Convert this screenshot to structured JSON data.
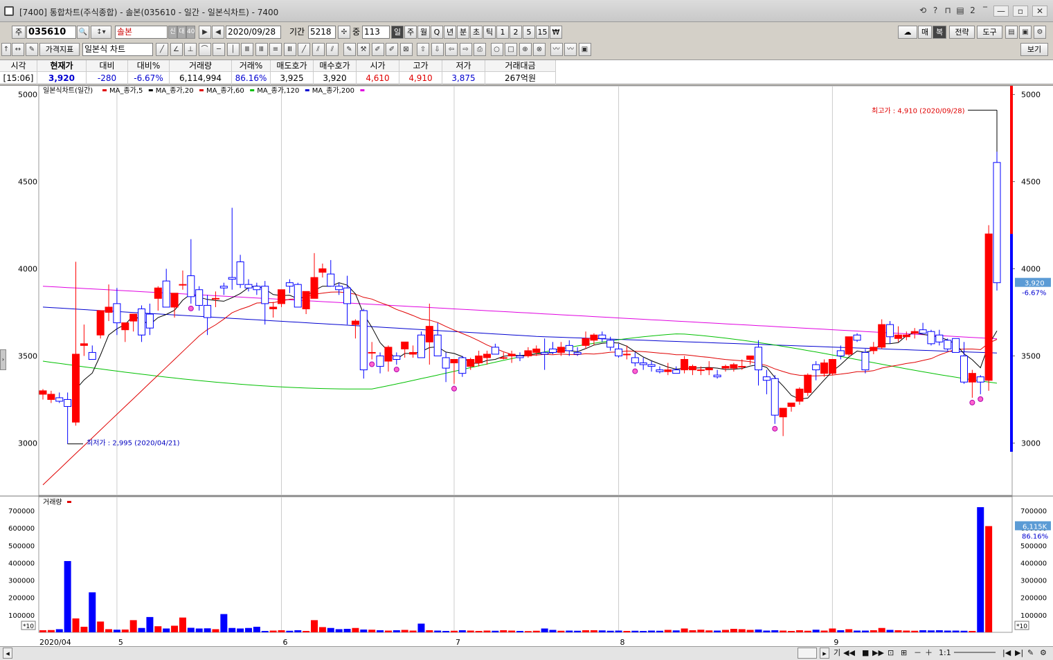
{
  "window": {
    "title": "[7400] 통합차트(주식종합) - 솔본(035610 - 일간 - 일본식차트) - 7400",
    "buttons": [
      "⟲",
      "?",
      "⊓",
      "▤",
      "2",
      "‾"
    ]
  },
  "toolbar": {
    "market_label": "주",
    "code": "035610",
    "name": "솔본",
    "small_labels": [
      "신",
      "대",
      "40"
    ],
    "date": "2020/09/28",
    "period_label": "기간",
    "period_value": "5218",
    "count_label": "중",
    "count_value": "113",
    "timeframes": [
      {
        "label": "일",
        "selected": true
      },
      {
        "label": "주"
      },
      {
        "label": "월"
      },
      {
        "label": "Q"
      },
      {
        "label": "년"
      },
      {
        "label": "분"
      },
      {
        "label": "초"
      },
      {
        "label": "틱"
      },
      {
        "label": "1"
      },
      {
        "label": "2"
      },
      {
        "label": "5"
      },
      {
        "label": "15"
      },
      {
        "label": "₩"
      }
    ],
    "right_buttons": [
      "매",
      "복",
      "전략",
      "도구"
    ],
    "indicator_label": "가격지표",
    "chart_type": "일본식 차트",
    "view_label": "보기"
  },
  "info": {
    "headers": [
      "시각",
      "현재가",
      "대비",
      "대비%",
      "거래량",
      "거래%",
      "매도호가",
      "매수호가",
      "시가",
      "고가",
      "저가",
      "거래대금"
    ],
    "values": [
      "[15:06]",
      "3,920",
      "-280",
      "-6.67%",
      "6,114,994",
      "86.16%",
      "3,925",
      "3,920",
      "4,610",
      "4,910",
      "3,875",
      "267억원"
    ]
  },
  "legend": {
    "title": "일본식차트(일간)",
    "items": [
      {
        "label": "MA_종가,5",
        "color": "#e00000"
      },
      {
        "label": "MA_종가,20",
        "color": "#000000"
      },
      {
        "label": "MA_종가,60",
        "color": "#e00000"
      },
      {
        "label": "MA_종가,120",
        "color": "#00c000"
      },
      {
        "label": "MA_종가,200",
        "color": "#0000d0"
      }
    ],
    "extra_color": "#e000e0"
  },
  "price_axis": {
    "ticks": [
      "5000",
      "4500",
      "4000",
      "3500",
      "3000"
    ]
  },
  "annotations": {
    "high": "최고가 : 4,910 (2020/09/28)",
    "low": "최저가 : 2,995 (2020/04/21)"
  },
  "current_label": {
    "price": "3,920",
    "change": "-6.67%"
  },
  "volume": {
    "title": "거래량",
    "ticks": [
      "700000",
      "600000",
      "500000",
      "400000",
      "300000",
      "200000",
      "100000"
    ],
    "unit": "*10",
    "current": "6,115K",
    "pct": "86.16%"
  },
  "x_axis": {
    "labels": [
      "2020/04",
      "5",
      "6",
      "7",
      "8",
      "9"
    ]
  },
  "bottom_nav": [
    "기",
    "◀◀",
    "■",
    "▶▶",
    "⊡",
    "⊞",
    "－",
    "＋",
    "1:1"
  ],
  "colors": {
    "up": "#ff0000",
    "down": "#0000ff",
    "bg": "#ffffff"
  },
  "chart_data": {
    "type": "candlestick",
    "title": "일본식차트(일간)",
    "ylim": [
      2700,
      5050
    ],
    "candles": [
      {
        "o": 3280,
        "h": 3310,
        "l": 3250,
        "c": 3300
      },
      {
        "o": 3250,
        "h": 3300,
        "l": 3230,
        "c": 3280
      },
      {
        "o": 3260,
        "h": 3290,
        "l": 3230,
        "c": 3240
      },
      {
        "o": 3250,
        "h": 3290,
        "l": 2995,
        "c": 3210
      },
      {
        "o": 3120,
        "h": 4040,
        "l": 3100,
        "c": 3510
      },
      {
        "o": 3560,
        "h": 3680,
        "l": 3500,
        "c": 3570
      },
      {
        "o": 3520,
        "h": 3560,
        "l": 3480,
        "c": 3480
      },
      {
        "o": 3620,
        "h": 3700,
        "l": 3600,
        "c": 3760
      },
      {
        "o": 3750,
        "h": 3910,
        "l": 3700,
        "c": 3780
      },
      {
        "o": 3800,
        "h": 3890,
        "l": 3620,
        "c": 3690
      },
      {
        "o": 3650,
        "h": 3690,
        "l": 3580,
        "c": 3690
      },
      {
        "o": 3700,
        "h": 3740,
        "l": 3640,
        "c": 3740
      },
      {
        "o": 3770,
        "h": 3790,
        "l": 3580,
        "c": 3620
      },
      {
        "o": 3740,
        "h": 3800,
        "l": 3620,
        "c": 3660
      },
      {
        "o": 3830,
        "h": 3900,
        "l": 3760,
        "c": 3890
      },
      {
        "o": 3930,
        "h": 4000,
        "l": 3830,
        "c": 3780
      },
      {
        "o": 3780,
        "h": 3860,
        "l": 3720,
        "c": 3860
      },
      {
        "o": 3910,
        "h": 3990,
        "l": 3880,
        "c": 3910
      },
      {
        "o": 3960,
        "h": 4170,
        "l": 3800,
        "c": 3840
      },
      {
        "o": 3880,
        "h": 3900,
        "l": 3760,
        "c": 3790
      },
      {
        "o": 3790,
        "h": 3850,
        "l": 3620,
        "c": 3720
      },
      {
        "o": 3830,
        "h": 3870,
        "l": 3780,
        "c": 3830
      },
      {
        "o": 3900,
        "h": 3920,
        "l": 3850,
        "c": 3890
      },
      {
        "o": 3950,
        "h": 4350,
        "l": 3880,
        "c": 3940
      },
      {
        "o": 4040,
        "h": 4080,
        "l": 3890,
        "c": 3910
      },
      {
        "o": 3910,
        "h": 3940,
        "l": 3870,
        "c": 3890
      },
      {
        "o": 3900,
        "h": 3920,
        "l": 3850,
        "c": 3880
      },
      {
        "o": 3900,
        "h": 3930,
        "l": 3680,
        "c": 3800
      },
      {
        "o": 3770,
        "h": 3810,
        "l": 3720,
        "c": 3780
      },
      {
        "o": 3800,
        "h": 3850,
        "l": 3780,
        "c": 3880
      },
      {
        "o": 3920,
        "h": 3940,
        "l": 3860,
        "c": 3900
      },
      {
        "o": 3910,
        "h": 3920,
        "l": 3780,
        "c": 3780
      },
      {
        "o": 3770,
        "h": 3870,
        "l": 3740,
        "c": 3870
      },
      {
        "o": 3830,
        "h": 4090,
        "l": 3830,
        "c": 3950
      },
      {
        "o": 3980,
        "h": 4030,
        "l": 3950,
        "c": 4000
      },
      {
        "o": 3970,
        "h": 4050,
        "l": 3900,
        "c": 3900
      },
      {
        "o": 3900,
        "h": 3920,
        "l": 3850,
        "c": 3880
      },
      {
        "o": 3890,
        "h": 3960,
        "l": 3680,
        "c": 3800
      },
      {
        "o": 3680,
        "h": 3710,
        "l": 3600,
        "c": 3700
      },
      {
        "o": 3760,
        "h": 3770,
        "l": 3370,
        "c": 3420
      },
      {
        "o": 3520,
        "h": 3580,
        "l": 3480,
        "c": 3520
      },
      {
        "o": 3500,
        "h": 3520,
        "l": 3400,
        "c": 3440
      },
      {
        "o": 3470,
        "h": 3560,
        "l": 3410,
        "c": 3550
      },
      {
        "o": 3500,
        "h": 3520,
        "l": 3450,
        "c": 3480
      },
      {
        "o": 3540,
        "h": 3580,
        "l": 3490,
        "c": 3580
      },
      {
        "o": 3510,
        "h": 3560,
        "l": 3490,
        "c": 3520
      },
      {
        "o": 3620,
        "h": 3640,
        "l": 3500,
        "c": 3490
      },
      {
        "o": 3580,
        "h": 3800,
        "l": 3450,
        "c": 3670
      },
      {
        "o": 3620,
        "h": 3690,
        "l": 3560,
        "c": 3500
      },
      {
        "o": 3490,
        "h": 3520,
        "l": 3350,
        "c": 3430
      },
      {
        "o": 3460,
        "h": 3480,
        "l": 3340,
        "c": 3480
      },
      {
        "o": 3490,
        "h": 3500,
        "l": 3380,
        "c": 3400
      },
      {
        "o": 3440,
        "h": 3490,
        "l": 3420,
        "c": 3480
      },
      {
        "o": 3460,
        "h": 3530,
        "l": 3440,
        "c": 3500
      },
      {
        "o": 3490,
        "h": 3530,
        "l": 3450,
        "c": 3510
      },
      {
        "o": 3550,
        "h": 3570,
        "l": 3520,
        "c": 3510
      },
      {
        "o": 3490,
        "h": 3520,
        "l": 3480,
        "c": 3490
      },
      {
        "o": 3500,
        "h": 3530,
        "l": 3460,
        "c": 3510
      },
      {
        "o": 3500,
        "h": 3520,
        "l": 3470,
        "c": 3490
      },
      {
        "o": 3500,
        "h": 3550,
        "l": 3490,
        "c": 3530
      },
      {
        "o": 3520,
        "h": 3560,
        "l": 3500,
        "c": 3540
      },
      {
        "o": 3520,
        "h": 3600,
        "l": 3420,
        "c": 3510
      },
      {
        "o": 3540,
        "h": 3580,
        "l": 3510,
        "c": 3520
      },
      {
        "o": 3520,
        "h": 3580,
        "l": 3500,
        "c": 3550
      },
      {
        "o": 3560,
        "h": 3590,
        "l": 3500,
        "c": 3530
      },
      {
        "o": 3520,
        "h": 3550,
        "l": 3500,
        "c": 3510
      },
      {
        "o": 3560,
        "h": 3640,
        "l": 3540,
        "c": 3600
      },
      {
        "o": 3590,
        "h": 3630,
        "l": 3560,
        "c": 3620
      },
      {
        "o": 3620,
        "h": 3640,
        "l": 3580,
        "c": 3600
      },
      {
        "o": 3590,
        "h": 3610,
        "l": 3530,
        "c": 3550
      },
      {
        "o": 3540,
        "h": 3570,
        "l": 3490,
        "c": 3500
      },
      {
        "o": 3510,
        "h": 3560,
        "l": 3480,
        "c": 3510
      },
      {
        "o": 3490,
        "h": 3520,
        "l": 3440,
        "c": 3460
      },
      {
        "o": 3460,
        "h": 3490,
        "l": 3420,
        "c": 3450
      },
      {
        "o": 3450,
        "h": 3470,
        "l": 3410,
        "c": 3440
      },
      {
        "o": 3420,
        "h": 3440,
        "l": 3400,
        "c": 3410
      },
      {
        "o": 3410,
        "h": 3460,
        "l": 3390,
        "c": 3420
      },
      {
        "o": 3420,
        "h": 3440,
        "l": 3400,
        "c": 3400
      },
      {
        "o": 3420,
        "h": 3500,
        "l": 3400,
        "c": 3480
      },
      {
        "o": 3420,
        "h": 3450,
        "l": 3390,
        "c": 3440
      },
      {
        "o": 3420,
        "h": 3440,
        "l": 3390,
        "c": 3420
      },
      {
        "o": 3420,
        "h": 3470,
        "l": 3390,
        "c": 3430
      },
      {
        "o": 3390,
        "h": 3420,
        "l": 3370,
        "c": 3380
      },
      {
        "o": 3430,
        "h": 3450,
        "l": 3410,
        "c": 3440
      },
      {
        "o": 3430,
        "h": 3460,
        "l": 3410,
        "c": 3450
      },
      {
        "o": 3440,
        "h": 3480,
        "l": 3420,
        "c": 3440
      },
      {
        "o": 3480,
        "h": 3500,
        "l": 3450,
        "c": 3500
      },
      {
        "o": 3550,
        "h": 3590,
        "l": 3330,
        "c": 3420
      },
      {
        "o": 3380,
        "h": 3420,
        "l": 3280,
        "c": 3360
      },
      {
        "o": 3370,
        "h": 3390,
        "l": 3110,
        "c": 3160
      },
      {
        "o": 3150,
        "h": 3200,
        "l": 3040,
        "c": 3200
      },
      {
        "o": 3210,
        "h": 3230,
        "l": 3180,
        "c": 3230
      },
      {
        "o": 3240,
        "h": 3320,
        "l": 3220,
        "c": 3310
      },
      {
        "o": 3290,
        "h": 3400,
        "l": 3270,
        "c": 3390
      },
      {
        "o": 3450,
        "h": 3470,
        "l": 3360,
        "c": 3420
      },
      {
        "o": 3400,
        "h": 3480,
        "l": 3380,
        "c": 3460
      },
      {
        "o": 3400,
        "h": 3480,
        "l": 3390,
        "c": 3480
      },
      {
        "o": 3530,
        "h": 3560,
        "l": 3480,
        "c": 3500
      },
      {
        "o": 3510,
        "h": 3600,
        "l": 3500,
        "c": 3610
      },
      {
        "o": 3620,
        "h": 3630,
        "l": 3580,
        "c": 3590
      },
      {
        "o": 3520,
        "h": 3540,
        "l": 3400,
        "c": 3420
      },
      {
        "o": 3530,
        "h": 3580,
        "l": 3510,
        "c": 3550
      },
      {
        "o": 3550,
        "h": 3710,
        "l": 3540,
        "c": 3680
      },
      {
        "o": 3680,
        "h": 3700,
        "l": 3570,
        "c": 3610
      },
      {
        "o": 3600,
        "h": 3670,
        "l": 3580,
        "c": 3620
      },
      {
        "o": 3610,
        "h": 3640,
        "l": 3590,
        "c": 3620
      },
      {
        "o": 3630,
        "h": 3660,
        "l": 3600,
        "c": 3640
      },
      {
        "o": 3650,
        "h": 3690,
        "l": 3630,
        "c": 3630
      },
      {
        "o": 3640,
        "h": 3650,
        "l": 3560,
        "c": 3570
      },
      {
        "o": 3620,
        "h": 3650,
        "l": 3560,
        "c": 3580
      },
      {
        "o": 3590,
        "h": 3600,
        "l": 3530,
        "c": 3540
      },
      {
        "o": 3600,
        "h": 3600,
        "l": 3520,
        "c": 3520
      },
      {
        "o": 3500,
        "h": 3580,
        "l": 3340,
        "c": 3350
      },
      {
        "o": 3350,
        "h": 3420,
        "l": 3260,
        "c": 3400
      },
      {
        "o": 3380,
        "h": 3390,
        "l": 3280,
        "c": 3350
      },
      {
        "o": 3360,
        "h": 4250,
        "l": 3300,
        "c": 4200
      },
      {
        "o": 4610,
        "h": 4910,
        "l": 3875,
        "c": 3920
      }
    ],
    "volume": [
      12000,
      13000,
      18000,
      410000,
      80000,
      32000,
      230000,
      62000,
      18000,
      15000,
      16000,
      70000,
      25000,
      88000,
      35000,
      22000,
      38000,
      85000,
      26000,
      22000,
      23000,
      18000,
      105000,
      25000,
      22000,
      25000,
      32000,
      8000,
      10000,
      12000,
      9000,
      12000,
      8000,
      70000,
      30000,
      25000,
      18000,
      20000,
      25000,
      16000,
      15000,
      12000,
      10000,
      12000,
      14000,
      10000,
      50000,
      12000,
      10000,
      8000,
      9000,
      12000,
      10000,
      8000,
      10000,
      9000,
      12000,
      10000,
      8000,
      7000,
      9000,
      22000,
      14000,
      9000,
      10000,
      9000,
      12000,
      12000,
      11000,
      9000,
      10000,
      8000,
      9000,
      8000,
      10000,
      9000,
      14000,
      11000,
      22000,
      12000,
      15000,
      11000,
      10000,
      14000,
      20000,
      18000,
      14000,
      16000,
      10000,
      12000,
      10000,
      8000,
      12000,
      9000,
      15000,
      10000,
      22000,
      12000,
      18000,
      10000,
      10000,
      12000,
      25000,
      14000,
      12000,
      10000,
      9000,
      12000,
      11000,
      12000,
      10000,
      10000,
      9000,
      8000,
      720000,
      611000
    ]
  }
}
